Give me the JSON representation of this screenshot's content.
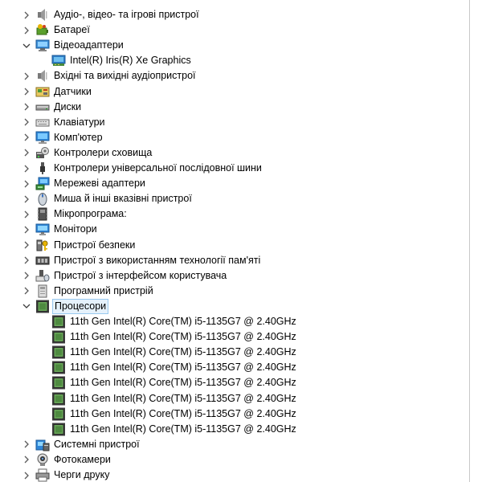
{
  "tree": {
    "rows": [
      {
        "level": 0,
        "expanded": false,
        "icon": "speaker-icon",
        "label": "Аудіо-, відео- та ігрові пристрої"
      },
      {
        "level": 0,
        "expanded": false,
        "icon": "battery-icon",
        "label": "Батареї"
      },
      {
        "level": 0,
        "expanded": true,
        "icon": "monitor-adapter-icon",
        "label": "Відеоадаптери"
      },
      {
        "level": 1,
        "icon": "display-adapter-icon",
        "label": "Intel(R) Iris(R) Xe Graphics"
      },
      {
        "level": 0,
        "expanded": false,
        "icon": "speaker-icon",
        "label": "Вхідні та вихідні аудіопристрої"
      },
      {
        "level": 0,
        "expanded": false,
        "icon": "sensor-icon",
        "label": "Датчики"
      },
      {
        "level": 0,
        "expanded": false,
        "icon": "disk-drive-icon",
        "label": "Диски"
      },
      {
        "level": 0,
        "expanded": false,
        "icon": "keyboard-icon",
        "label": "Клавіатури"
      },
      {
        "level": 0,
        "expanded": false,
        "icon": "computer-icon",
        "label": "Комп'ютер"
      },
      {
        "level": 0,
        "expanded": false,
        "icon": "storage-controller-icon",
        "label": "Контролери сховища"
      },
      {
        "level": 0,
        "expanded": false,
        "icon": "usb-icon",
        "label": "Контролери універсальної послідовної шини"
      },
      {
        "level": 0,
        "expanded": false,
        "icon": "network-adapter-icon",
        "label": "Мережеві адаптери"
      },
      {
        "level": 0,
        "expanded": false,
        "icon": "mouse-icon",
        "label": "Миша й інші вказівні пристрої"
      },
      {
        "level": 0,
        "expanded": false,
        "icon": "firmware-icon",
        "label": "Мікропрограма:"
      },
      {
        "level": 0,
        "expanded": false,
        "icon": "monitor-icon",
        "label": "Монітори"
      },
      {
        "level": 0,
        "expanded": false,
        "icon": "security-key-icon",
        "label": "Пристрої безпеки"
      },
      {
        "level": 0,
        "expanded": false,
        "icon": "memory-device-icon",
        "label": "Пристрої з використанням технології пам'яті"
      },
      {
        "level": 0,
        "expanded": false,
        "icon": "hid-icon",
        "label": "Пристрої з інтерфейсом користувача"
      },
      {
        "level": 0,
        "expanded": false,
        "icon": "software-device-icon",
        "label": "Програмний пристрій"
      },
      {
        "level": 0,
        "expanded": true,
        "selected": true,
        "icon": "processor-icon",
        "label": "Процесори"
      },
      {
        "level": 1,
        "icon": "processor-icon",
        "label": "11th Gen Intel(R) Core(TM) i5-1135G7 @ 2.40GHz"
      },
      {
        "level": 1,
        "icon": "processor-icon",
        "label": "11th Gen Intel(R) Core(TM) i5-1135G7 @ 2.40GHz"
      },
      {
        "level": 1,
        "icon": "processor-icon",
        "label": "11th Gen Intel(R) Core(TM) i5-1135G7 @ 2.40GHz"
      },
      {
        "level": 1,
        "icon": "processor-icon",
        "label": "11th Gen Intel(R) Core(TM) i5-1135G7 @ 2.40GHz"
      },
      {
        "level": 1,
        "icon": "processor-icon",
        "label": "11th Gen Intel(R) Core(TM) i5-1135G7 @ 2.40GHz"
      },
      {
        "level": 1,
        "icon": "processor-icon",
        "label": "11th Gen Intel(R) Core(TM) i5-1135G7 @ 2.40GHz"
      },
      {
        "level": 1,
        "icon": "processor-icon",
        "label": "11th Gen Intel(R) Core(TM) i5-1135G7 @ 2.40GHz"
      },
      {
        "level": 1,
        "icon": "processor-icon",
        "label": "11th Gen Intel(R) Core(TM) i5-1135G7 @ 2.40GHz"
      },
      {
        "level": 0,
        "expanded": false,
        "icon": "system-devices-icon",
        "label": "Системні пристрої"
      },
      {
        "level": 0,
        "expanded": false,
        "icon": "camera-icon",
        "label": "Фотокамери"
      },
      {
        "level": 0,
        "expanded": false,
        "icon": "print-queue-icon",
        "label": "Черги друку"
      }
    ]
  }
}
